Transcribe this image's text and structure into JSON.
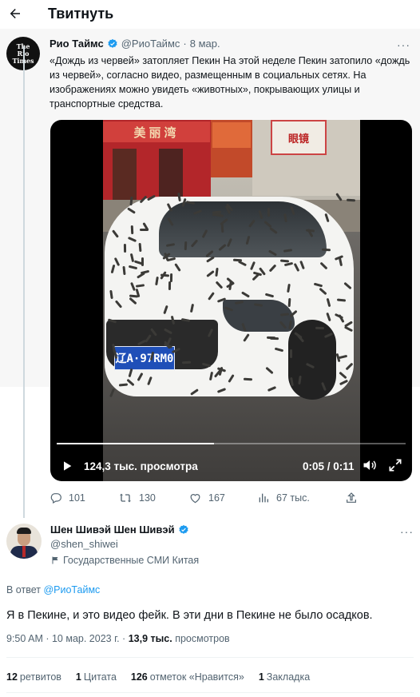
{
  "header": {
    "title": "Твитнуть"
  },
  "quoted": {
    "avatar_text": [
      "The",
      "Rio",
      "Times"
    ],
    "name": "Рио Таймс",
    "handle": "@РиоТаймс",
    "date": "8 мар.",
    "text": "«Дождь из червей» затопляет Пекин На этой неделе Пекин затопило «дождь из червей», согласно видео, размещенным в социальных сетях. На изображениях можно увидеть «животных», покрывающих улицы и транспортные средства.",
    "video": {
      "views": "124,3 тыс. просмотра",
      "time": "0:05 / 0:11",
      "progress": 0.45,
      "plate": "辽A·97RM0",
      "sign_red": "美丽湾",
      "sign_white": "眼镜"
    },
    "actions": {
      "replies": "101",
      "retweets": "130",
      "likes": "167",
      "views": "67 тыс."
    }
  },
  "author": {
    "name": "Шен Шивэй Шен Шивэй",
    "handle": "@shen_shiwei",
    "affiliation": "Государственные СМИ Китая"
  },
  "tweet": {
    "reply_prefix": "В ответ",
    "reply_to": "@РиоТаймс",
    "text": "Я в Пекине, и это видео фейк. В эти дни в Пекине не было осадков.",
    "time": "9:50 AM · 10 мар. 2023 г. · ",
    "views_count": "13,9 тыс.",
    "views_label": "просмотров"
  },
  "stats": {
    "retweets_count": "12",
    "retweets_label": "ретвитов",
    "quotes_count": "1",
    "quotes_label": "Цитата",
    "likes_count": "126",
    "likes_label": "отметок «Нравится»",
    "bookmarks_count": "1",
    "bookmarks_label": "Закладка"
  },
  "colors": {
    "accent": "#1d9bf0",
    "muted": "#536471",
    "verified": "#1d9bf0",
    "affiliate_flag": "#de2910"
  }
}
